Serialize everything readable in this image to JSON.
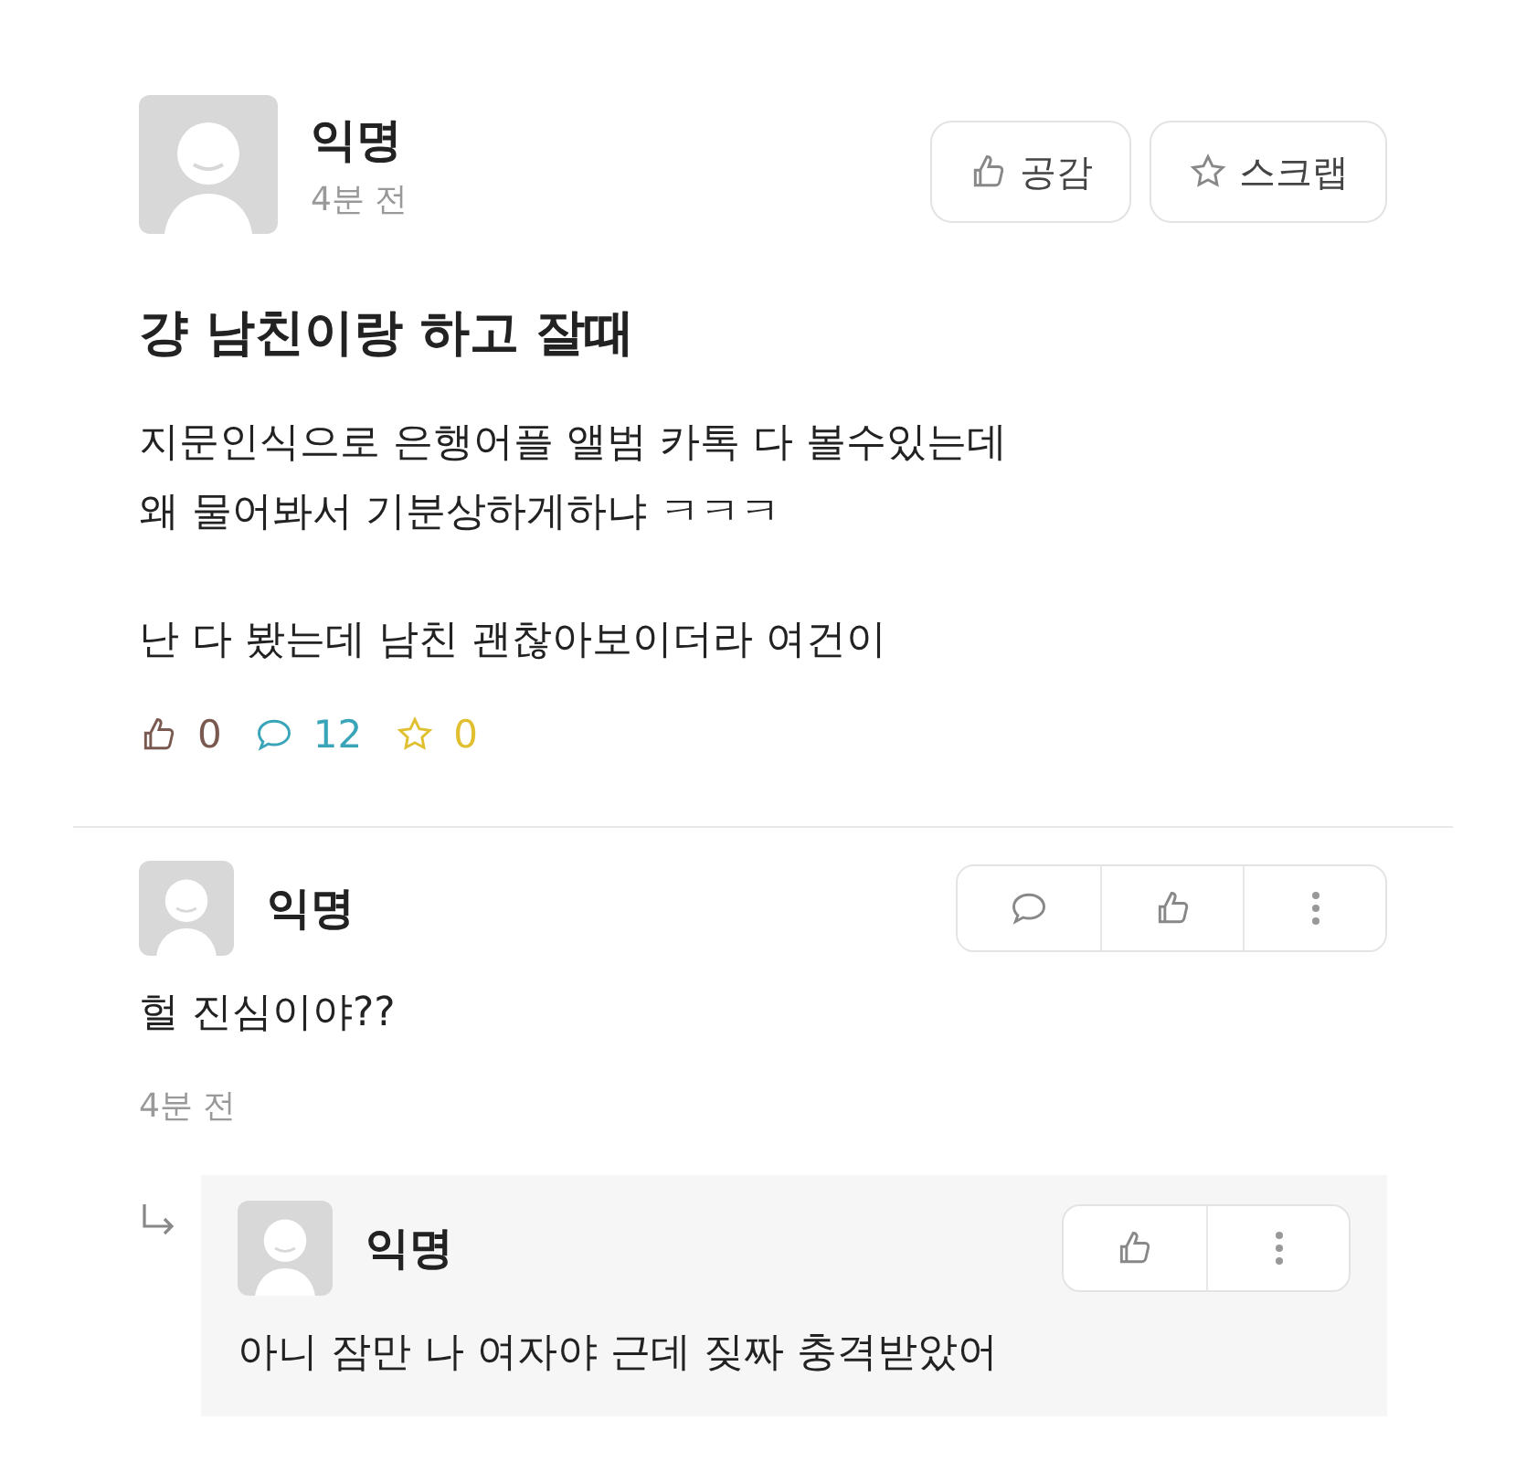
{
  "post": {
    "author": "익명",
    "time": "4분 전",
    "buttons": [
      {
        "kind": "like",
        "label": "공감"
      },
      {
        "kind": "scrap",
        "label": "스크랩"
      }
    ],
    "title": "걍 남친이랑 하고 잘때",
    "paragraphs": [
      "지문인식으로 은행어플 앨범 카톡 다 볼수있는데\n왜 물어봐서 기분상하게하냐 ㅋㅋㅋ",
      "난 다 봤는데 남친 괜찮아보이더라 여건이"
    ],
    "stats": [
      {
        "kind": "like",
        "count": "0",
        "color": "#7a5a50"
      },
      {
        "kind": "comment",
        "count": "12",
        "color": "#3aa5b8"
      },
      {
        "kind": "scrap",
        "count": "0",
        "color": "#e0c030"
      }
    ]
  },
  "comments": [
    {
      "author": "익명",
      "text": "헐 진심이야??",
      "time": "4분 전",
      "actions": [
        {
          "kind": "reply"
        },
        {
          "kind": "like"
        },
        {
          "kind": "more"
        }
      ],
      "replies": [
        {
          "author": "익명",
          "text": "아니 잠만 나 여자야 근데 짖짜 충격받았어",
          "actions": [
            {
              "kind": "like"
            },
            {
              "kind": "more"
            }
          ]
        }
      ]
    }
  ]
}
